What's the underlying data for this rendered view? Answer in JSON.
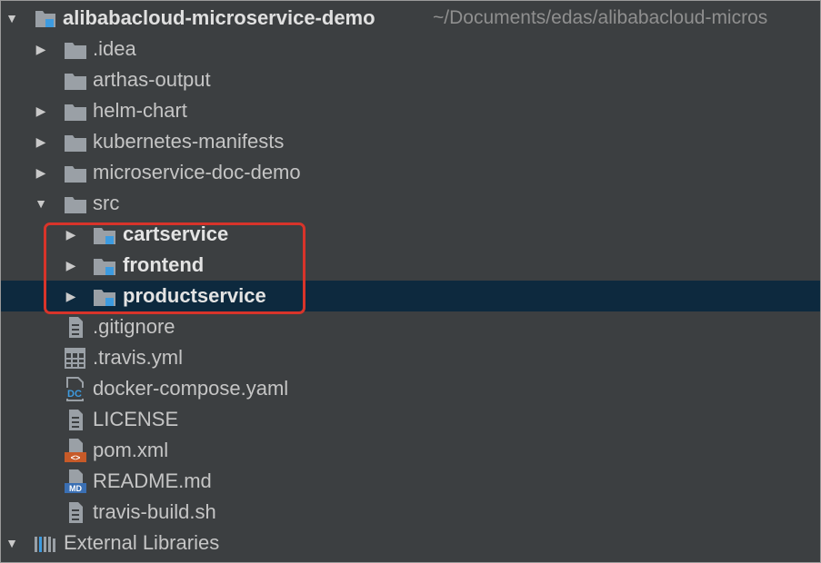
{
  "project": {
    "name": "alibabacloud-microservice-demo",
    "path": "~/Documents/edas/alibabacloud-micros"
  },
  "folders": [
    {
      "label": ".idea"
    },
    {
      "label": "arthas-output"
    },
    {
      "label": "helm-chart"
    },
    {
      "label": "kubernetes-manifests"
    },
    {
      "label": "microservice-doc-demo"
    },
    {
      "label": "src"
    }
  ],
  "modules": [
    {
      "label": "cartservice"
    },
    {
      "label": "frontend"
    },
    {
      "label": "productservice"
    }
  ],
  "files": [
    {
      "label": ".gitignore",
      "icon": "text-file-icon"
    },
    {
      "label": ".travis.yml",
      "icon": "yaml-file-icon"
    },
    {
      "label": "docker-compose.yaml",
      "icon": "docker-compose-file-icon",
      "badge": "DC"
    },
    {
      "label": "LICENSE",
      "icon": "text-file-icon"
    },
    {
      "label": "pom.xml",
      "icon": "xml-file-icon",
      "badge": "<>"
    },
    {
      "label": "README.md",
      "icon": "markdown-file-icon",
      "badge": "MD"
    },
    {
      "label": "travis-build.sh",
      "icon": "text-file-icon"
    }
  ],
  "external": {
    "label": "External Libraries"
  },
  "colors": {
    "background": "#3c3f41",
    "selection": "#0d293e",
    "highlight_border": "#d8342a",
    "module_badge": "#3d9be0",
    "xml_badge": "#c75a28",
    "md_badge": "#3a6fb3"
  }
}
